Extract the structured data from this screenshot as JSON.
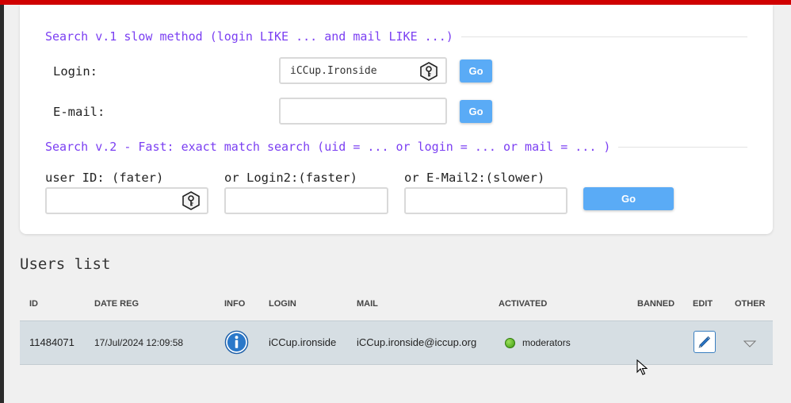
{
  "search_v1": {
    "title": "Search v.1 slow method (login LIKE ... and mail LIKE ...)",
    "login_label": "Login:",
    "login_value": "iCCup.Ironside",
    "email_label": "E-mail:",
    "email_value": "",
    "go_label": "Go"
  },
  "search_v2": {
    "title": "Search v.2 - Fast: exact match search (uid = ... or login = ... or mail = ... )",
    "uid_label": "user ID: (fater)",
    "login2_label": "or Login2:(faster)",
    "email2_label": "or E-Mail2:(slower)",
    "go_label": "Go"
  },
  "users_list": {
    "title": "Users list",
    "columns": [
      "ID",
      "DATE REG",
      "INFO",
      "LOGIN",
      "MAIL",
      "ACTIVATED",
      "BANNED",
      "EDIT",
      "OTHER"
    ],
    "rows": [
      {
        "id": "11484071",
        "date_reg": "17/Jul/2024 12:09:58",
        "login": "iCCup.ironside",
        "mail": "iCCup.ironside@iccup.org",
        "activated": "moderators",
        "banned": ""
      }
    ]
  },
  "colors": {
    "accent": "#7b3ff2",
    "button": "#5aabf6",
    "topbar": "#d00000",
    "row_bg": "#d6dee3",
    "status_active": "#4caf1a"
  },
  "icons": {
    "key": "key-icon",
    "info": "info-icon",
    "edit": "pencil-icon",
    "other": "chevron-down-icon"
  }
}
